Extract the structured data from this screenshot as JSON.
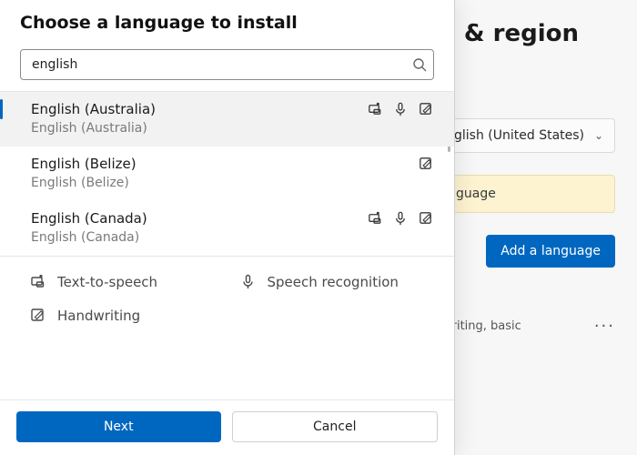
{
  "background": {
    "title": "e & region",
    "select_value": "glish (United States)",
    "banner": "guage",
    "add_button": "Add a language",
    "lang_line": "writing, basic"
  },
  "dialog": {
    "title": "Choose a language to install",
    "search_value": "english",
    "next": "Next",
    "cancel": "Cancel",
    "legend": {
      "tts": "Text-to-speech",
      "speech": "Speech recognition",
      "handwriting": "Handwriting"
    },
    "items": [
      {
        "primary": "English (Australia)",
        "secondary": "English (Australia)",
        "features": [
          "tts",
          "speech",
          "handwriting"
        ],
        "selected": true
      },
      {
        "primary": "English (Belize)",
        "secondary": "English (Belize)",
        "features": [
          "handwriting"
        ],
        "selected": false
      },
      {
        "primary": "English (Canada)",
        "secondary": "English (Canada)",
        "features": [
          "tts",
          "speech",
          "handwriting"
        ],
        "selected": false
      }
    ]
  }
}
